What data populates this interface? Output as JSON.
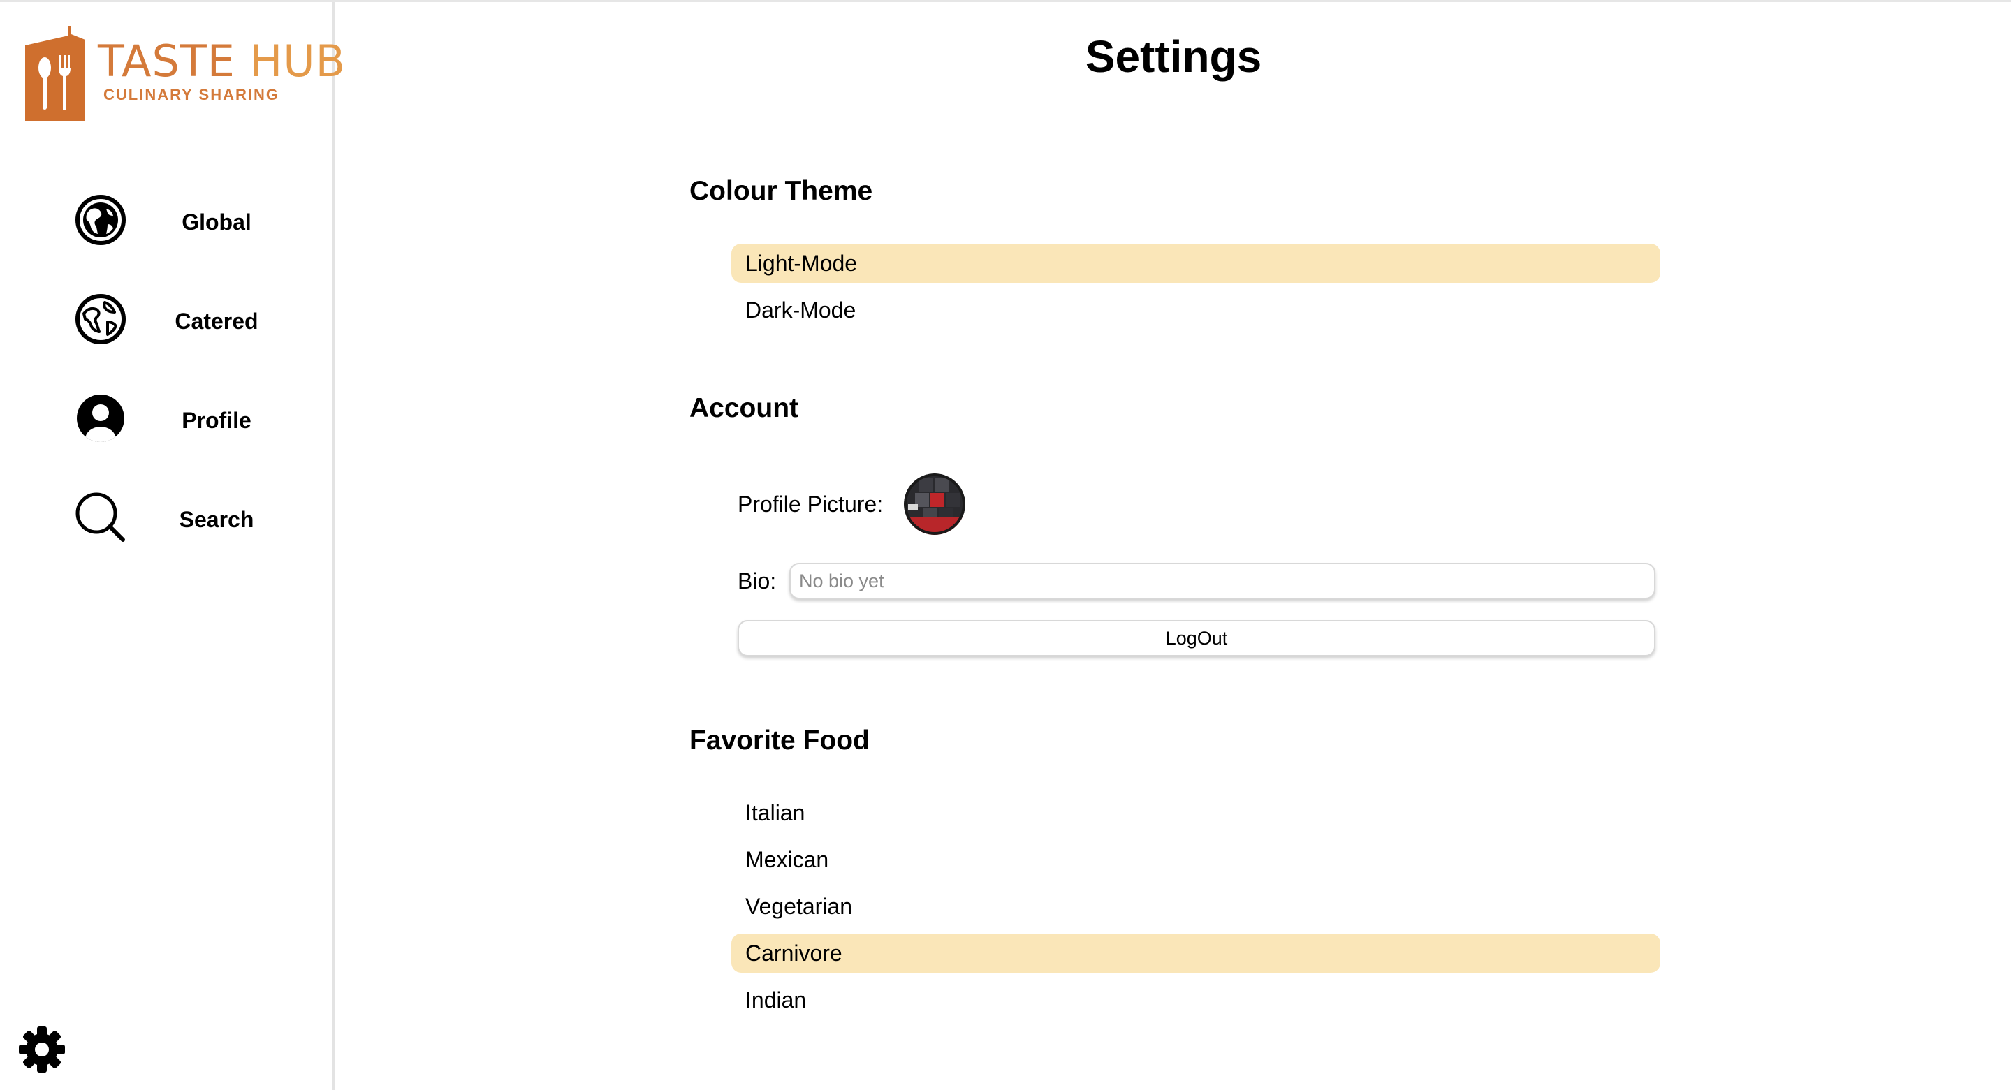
{
  "brand": {
    "title_main": "TASTE",
    "title_accent": "HUB",
    "subtitle": "CULINARY SHARING",
    "color": "#d47a3a",
    "accent_color": "#e49a4a"
  },
  "sidebar": {
    "items": [
      {
        "label": "Global",
        "icon": "globe-filled-icon"
      },
      {
        "label": "Catered",
        "icon": "globe-outline-icon"
      },
      {
        "label": "Profile",
        "icon": "user-circle-icon"
      },
      {
        "label": "Search",
        "icon": "search-icon"
      }
    ],
    "settings_icon": "gear-icon"
  },
  "page": {
    "title": "Settings"
  },
  "colour_theme": {
    "heading": "Colour Theme",
    "options": [
      "Light-Mode",
      "Dark-Mode"
    ],
    "selected": "Light-Mode"
  },
  "account": {
    "heading": "Account",
    "profile_picture_label": "Profile Picture:",
    "bio_label": "Bio:",
    "bio_value": "",
    "bio_placeholder": "No bio yet",
    "logout_label": "LogOut"
  },
  "favorite_food": {
    "heading": "Favorite Food",
    "options": [
      "Italian",
      "Mexican",
      "Vegetarian",
      "Carnivore",
      "Indian"
    ],
    "selected": "Carnivore"
  },
  "colors": {
    "selected_highlight": "#fae6b8",
    "sidebar_border": "#e3e3e3"
  }
}
